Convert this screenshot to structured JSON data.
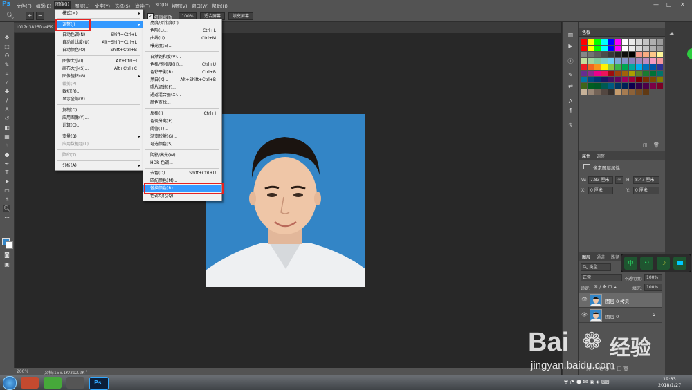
{
  "app": {
    "logo": "Ps"
  },
  "menubar": {
    "items": [
      "文件(F)",
      "编辑(E)",
      "图像(I)",
      "图层(L)",
      "文字(Y)",
      "选择(S)",
      "滤镜(T)",
      "3D(D)",
      "视图(V)",
      "窗口(W)",
      "帮助(H)"
    ],
    "window_buttons": [
      "—",
      "□",
      "✕"
    ]
  },
  "options": {
    "checkbox_label": "细微缩放",
    "zoom_value": "100%",
    "fit_screen": "适合屏幕",
    "fill_screen": "填充屏幕"
  },
  "document": {
    "tab_title": "t017d3825fce459"
  },
  "status": {
    "zoom": "200%",
    "doc_size": "文档:156.1K/312.2K"
  },
  "image_menu": {
    "items": [
      {
        "label": "模式(M)",
        "shortcut": "",
        "submenu": true
      },
      {
        "sep": true
      },
      {
        "label": "调整(J)",
        "shortcut": "",
        "submenu": true,
        "highlight": true
      },
      {
        "sep": true
      },
      {
        "label": "自动色调(N)",
        "shortcut": "Shift+Ctrl+L"
      },
      {
        "label": "自动对比度(U)",
        "shortcut": "Alt+Shift+Ctrl+L"
      },
      {
        "label": "自动颜色(O)",
        "shortcut": "Shift+Ctrl+B"
      },
      {
        "sep": true
      },
      {
        "label": "图像大小(I)...",
        "shortcut": "Alt+Ctrl+I"
      },
      {
        "label": "画布大小(S)...",
        "shortcut": "Alt+Ctrl+C"
      },
      {
        "label": "图像旋转(G)",
        "shortcut": "",
        "submenu": true
      },
      {
        "label": "裁剪(P)",
        "shortcut": "",
        "disabled": true
      },
      {
        "label": "裁切(R)...",
        "shortcut": ""
      },
      {
        "label": "显示全部(V)",
        "shortcut": ""
      },
      {
        "sep": true
      },
      {
        "label": "复制(D)...",
        "shortcut": ""
      },
      {
        "label": "应用图像(Y)...",
        "shortcut": ""
      },
      {
        "label": "计算(C)...",
        "shortcut": ""
      },
      {
        "sep": true
      },
      {
        "label": "变量(B)",
        "shortcut": "",
        "submenu": true
      },
      {
        "label": "应用数据组(L)...",
        "shortcut": "",
        "disabled": true
      },
      {
        "sep": true
      },
      {
        "label": "陷印(T)...",
        "shortcut": "",
        "disabled": true
      },
      {
        "sep": true
      },
      {
        "label": "分析(A)",
        "shortcut": "",
        "submenu": true
      }
    ]
  },
  "adjust_menu": {
    "items": [
      {
        "label": "亮度/对比度(C)...",
        "shortcut": ""
      },
      {
        "label": "色阶(L)...",
        "shortcut": "Ctrl+L"
      },
      {
        "label": "曲线(U)...",
        "shortcut": "Ctrl+M"
      },
      {
        "label": "曝光度(E)...",
        "shortcut": ""
      },
      {
        "sep": true
      },
      {
        "label": "自然饱和度(V)...",
        "shortcut": ""
      },
      {
        "label": "色相/饱和度(H)...",
        "shortcut": "Ctrl+U"
      },
      {
        "label": "色彩平衡(B)...",
        "shortcut": "Ctrl+B"
      },
      {
        "label": "黑白(K)...",
        "shortcut": "Alt+Shift+Ctrl+B"
      },
      {
        "label": "照片滤镜(F)...",
        "shortcut": ""
      },
      {
        "label": "通道混合器(X)...",
        "shortcut": ""
      },
      {
        "label": "颜色查找...",
        "shortcut": ""
      },
      {
        "sep": true
      },
      {
        "label": "反相(I)",
        "shortcut": "Ctrl+I"
      },
      {
        "label": "色调分离(P)...",
        "shortcut": ""
      },
      {
        "label": "阈值(T)...",
        "shortcut": ""
      },
      {
        "label": "渐变映射(G)...",
        "shortcut": ""
      },
      {
        "label": "可选颜色(S)...",
        "shortcut": ""
      },
      {
        "sep": true
      },
      {
        "label": "阴影/高光(W)...",
        "shortcut": ""
      },
      {
        "label": "HDR 色调...",
        "shortcut": ""
      },
      {
        "sep": true
      },
      {
        "label": "去色(D)",
        "shortcut": "Shift+Ctrl+U"
      },
      {
        "label": "匹配颜色(M)...",
        "shortcut": ""
      },
      {
        "label": "替换颜色(R)...",
        "shortcut": "",
        "highlight": true
      },
      {
        "label": "色调均化(Q)",
        "shortcut": ""
      }
    ]
  },
  "swatches": {
    "tab": "色板",
    "colors": [
      "#ff0000",
      "#ffff00",
      "#00ff00",
      "#00ffff",
      "#0000ff",
      "#ff00ff",
      "#ffffff",
      "#ebebeb",
      "#d7d7d7",
      "#c3c3c3",
      "#afafaf",
      "#9b9b9b",
      "#ff0000",
      "#ffff00",
      "#00ff00",
      "#00ffff",
      "#0000ff",
      "#ff00ff",
      "#ffffff",
      "#ebebeb",
      "#d7d7d7",
      "#c3c3c3",
      "#afafaf",
      "#9b9b9b",
      "#878787",
      "#737373",
      "#5f5f5f",
      "#4b4b4b",
      "#373737",
      "#232323",
      "#0f0f0f",
      "#000000",
      "#f6998a",
      "#f9ad81",
      "#fdc689",
      "#fff799",
      "#c4df9b",
      "#a3d39c",
      "#82ca9d",
      "#7bcdc8",
      "#6dcff6",
      "#7da7d9",
      "#8393ca",
      "#8781bd",
      "#a186be",
      "#bd8cbf",
      "#f49ac1",
      "#f5989d",
      "#ed1c24",
      "#f26522",
      "#f7941d",
      "#fff200",
      "#8dc63f",
      "#39b54a",
      "#00a651",
      "#00a99d",
      "#00aeef",
      "#0072bc",
      "#0054a6",
      "#2e3192",
      "#662d91",
      "#92278f",
      "#ec008c",
      "#ed145b",
      "#9e0b0f",
      "#a0410d",
      "#a3620a",
      "#aba000",
      "#598527",
      "#197b30",
      "#007236",
      "#00746b",
      "#0076a3",
      "#004a80",
      "#003471",
      "#1b1464",
      "#440e62",
      "#630460",
      "#9e005d",
      "#9e0039",
      "#790000",
      "#7b2e00",
      "#7d4900",
      "#827b00",
      "#406618",
      "#005e20",
      "#005826",
      "#005952",
      "#005b7f",
      "#003663",
      "#002157",
      "#0d004c",
      "#32004b",
      "#4b0049",
      "#7b0046",
      "#7a0026",
      "#c7b299",
      "#998675",
      "#736357",
      "#534741",
      "#37302c",
      "#c69c6d",
      "#a67c52",
      "#8c6239",
      "#754c24",
      "#603913"
    ]
  },
  "properties": {
    "tabs": [
      "属性",
      "调整"
    ],
    "title": "像素图层属性",
    "w_label": "W:",
    "w_value": "7.83 厘米",
    "link_icon": "∞",
    "h_label": "H:",
    "h_value": "8.47 厘米",
    "x_label": "X:",
    "x_value": "0 厘米",
    "y_label": "Y:",
    "y_value": "0 厘米"
  },
  "layers": {
    "tabs": [
      "图层",
      "通道",
      "路径"
    ],
    "kind": "类型",
    "blend": "正常",
    "opacity_label": "不透明度:",
    "opacity": "100%",
    "lock_label": "锁定:",
    "fill_label": "填充:",
    "fill": "100%",
    "rows": [
      {
        "name": "图层 0 拷贝"
      },
      {
        "name": "图层 0"
      }
    ]
  },
  "floating": {
    "labels": [
      "中",
      "•)",
      "☽",
      ""
    ]
  },
  "taskbar": {
    "time": "19:33",
    "date": "2018/1/27"
  },
  "watermark": {
    "brand": "Bai",
    "brand2": "经验",
    "url": "jingyan.baidu.com"
  }
}
